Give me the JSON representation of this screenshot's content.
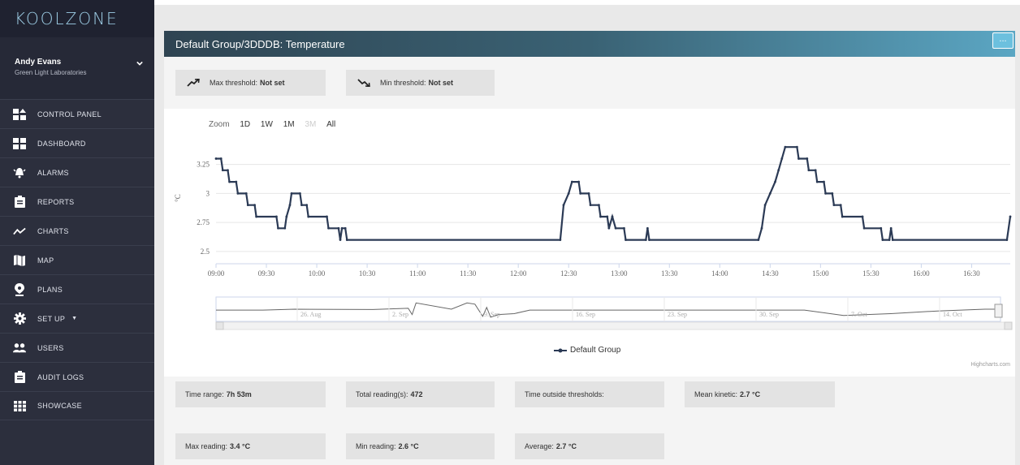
{
  "brand": "KOOLZONE",
  "user": {
    "name": "Andy Evans",
    "org": "Green Light Laboratories"
  },
  "nav": [
    {
      "label": "CONTROL PANEL",
      "icon": "control-panel-icon"
    },
    {
      "label": "DASHBOARD",
      "icon": "dashboard-icon"
    },
    {
      "label": "ALARMS",
      "icon": "alarm-bell-icon"
    },
    {
      "label": "REPORTS",
      "icon": "clipboard-icon"
    },
    {
      "label": "CHARTS",
      "icon": "line-chart-icon"
    },
    {
      "label": "MAP",
      "icon": "map-icon"
    },
    {
      "label": "PLANS",
      "icon": "location-pin-icon"
    },
    {
      "label": "SET UP",
      "icon": "gear-icon"
    },
    {
      "label": "USERS",
      "icon": "users-icon"
    },
    {
      "label": "AUDIT LOGS",
      "icon": "clipboard-icon"
    },
    {
      "label": "SHOWCASE",
      "icon": "grid-icon"
    }
  ],
  "panel": {
    "title": "Default Group/3DDDB: Temperature",
    "menu_label": "...",
    "max_threshold": {
      "label": "Max threshold:",
      "value": "Not set"
    },
    "min_threshold": {
      "label": "Min threshold:",
      "value": "Not set"
    }
  },
  "zoom": {
    "label": "Zoom",
    "options": [
      "1D",
      "1W",
      "1M",
      "3M",
      "All"
    ],
    "disabled": [
      "3M"
    ]
  },
  "chart_data": {
    "type": "line",
    "ylabel": "°C",
    "ylim": [
      2.45,
      3.45
    ],
    "yticks": [
      "2.5",
      "2.75",
      "3",
      "3.25"
    ],
    "xticks": [
      "09:00",
      "09:30",
      "10:00",
      "10:30",
      "11:00",
      "11:30",
      "12:00",
      "12:30",
      "13:00",
      "13:30",
      "14:00",
      "14:30",
      "15:00",
      "15:30",
      "16:00",
      "16:30"
    ],
    "series": [
      {
        "name": "Default Group",
        "color": "#2b3a55",
        "points": [
          [
            0,
            3.3
          ],
          [
            3,
            3.3
          ],
          [
            4,
            3.2
          ],
          [
            7,
            3.2
          ],
          [
            8,
            3.1
          ],
          [
            12,
            3.1
          ],
          [
            13,
            3.0
          ],
          [
            18,
            3.0
          ],
          [
            19,
            2.9
          ],
          [
            23,
            2.9
          ],
          [
            24,
            2.8
          ],
          [
            36,
            2.8
          ],
          [
            37,
            2.7
          ],
          [
            41,
            2.7
          ],
          [
            42,
            2.8
          ],
          [
            44,
            2.9
          ],
          [
            45,
            3.0
          ],
          [
            50,
            3.0
          ],
          [
            51,
            2.9
          ],
          [
            54,
            2.9
          ],
          [
            55,
            2.8
          ],
          [
            66,
            2.8
          ],
          [
            67,
            2.7
          ],
          [
            73,
            2.7
          ],
          [
            74,
            2.6
          ],
          [
            75,
            2.7
          ],
          [
            77,
            2.7
          ],
          [
            78,
            2.6
          ],
          [
            205,
            2.6
          ],
          [
            207,
            2.9
          ],
          [
            210,
            3.0
          ],
          [
            212,
            3.1
          ],
          [
            216,
            3.1
          ],
          [
            217,
            3.0
          ],
          [
            222,
            3.0
          ],
          [
            223,
            2.9
          ],
          [
            228,
            2.9
          ],
          [
            229,
            2.8
          ],
          [
            233,
            2.8
          ],
          [
            234,
            2.7
          ],
          [
            236,
            2.8
          ],
          [
            238,
            2.7
          ],
          [
            243,
            2.7
          ],
          [
            244,
            2.6
          ],
          [
            256,
            2.6
          ],
          [
            257,
            2.7
          ],
          [
            258,
            2.6
          ],
          [
            323,
            2.6
          ],
          [
            325,
            2.7
          ],
          [
            327,
            2.9
          ],
          [
            330,
            3.0
          ],
          [
            333,
            3.1
          ],
          [
            335,
            3.2
          ],
          [
            337,
            3.3
          ],
          [
            339,
            3.4
          ],
          [
            346,
            3.4
          ],
          [
            347,
            3.3
          ],
          [
            352,
            3.3
          ],
          [
            353,
            3.2
          ],
          [
            357,
            3.2
          ],
          [
            358,
            3.1
          ],
          [
            362,
            3.1
          ],
          [
            363,
            3.0
          ],
          [
            367,
            3.0
          ],
          [
            368,
            2.9
          ],
          [
            372,
            2.9
          ],
          [
            373,
            2.8
          ],
          [
            385,
            2.8
          ],
          [
            386,
            2.7
          ],
          [
            396,
            2.7
          ],
          [
            397,
            2.6
          ],
          [
            401,
            2.6
          ],
          [
            402,
            2.7
          ],
          [
            403,
            2.6
          ],
          [
            471,
            2.6
          ],
          [
            473,
            2.8
          ]
        ],
        "x_unit": "minutes from 09:00"
      }
    ],
    "navigator": {
      "ticks": [
        "26. Aug",
        "2. Sep",
        "9. Sep",
        "16. Sep",
        "23. Sep",
        "30. Sep",
        "7. Oct",
        "14. Oct"
      ]
    },
    "legend": "Default Group",
    "credit": "Highcharts.com"
  },
  "stats": {
    "time_range": {
      "label": "Time range:",
      "value": "7h 53m"
    },
    "total_readings": {
      "label": "Total reading(s):",
      "value": "472"
    },
    "time_outside": {
      "label": "Time outside thresholds:",
      "value": ""
    },
    "mean_kinetic": {
      "label": "Mean kinetic:",
      "value": "2.7 °C"
    },
    "max_reading": {
      "label": "Max reading:",
      "value": "3.4 °C"
    },
    "min_reading": {
      "label": "Min reading:",
      "value": "2.6 °C"
    },
    "average": {
      "label": "Average:",
      "value": "2.7 °C"
    }
  }
}
